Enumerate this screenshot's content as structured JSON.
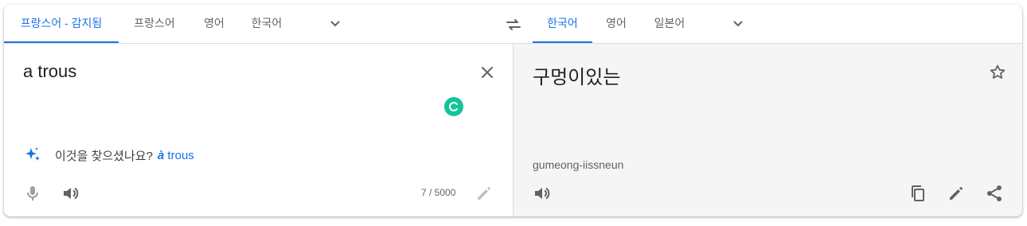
{
  "source_langs": {
    "tabs": [
      "프랑스어 - 감지됨",
      "프랑스어",
      "영어",
      "한국어"
    ]
  },
  "target_langs": {
    "tabs": [
      "한국어",
      "영어",
      "일본어"
    ]
  },
  "source": {
    "text": "a trous",
    "suggestion_prefix": "이것을 찾으셨나요?",
    "suggestion_accent": "à",
    "suggestion_rest": " trous",
    "char_count": "7 / 5000"
  },
  "target": {
    "text": "구멍이있는",
    "romanization": "gumeong-iissneun"
  },
  "colors": {
    "accent": "#1a73e8",
    "grammarly": "#15c39a",
    "target_bg": "#f5f5f5"
  },
  "icons": {
    "swap": "swap-icon",
    "clear": "close-icon",
    "sparkle": "sparkle-icon",
    "mic": "mic-icon",
    "speaker": "speaker-icon",
    "edit": "pencil-icon",
    "star": "star-icon",
    "copy": "copy-icon",
    "share": "share-icon"
  }
}
